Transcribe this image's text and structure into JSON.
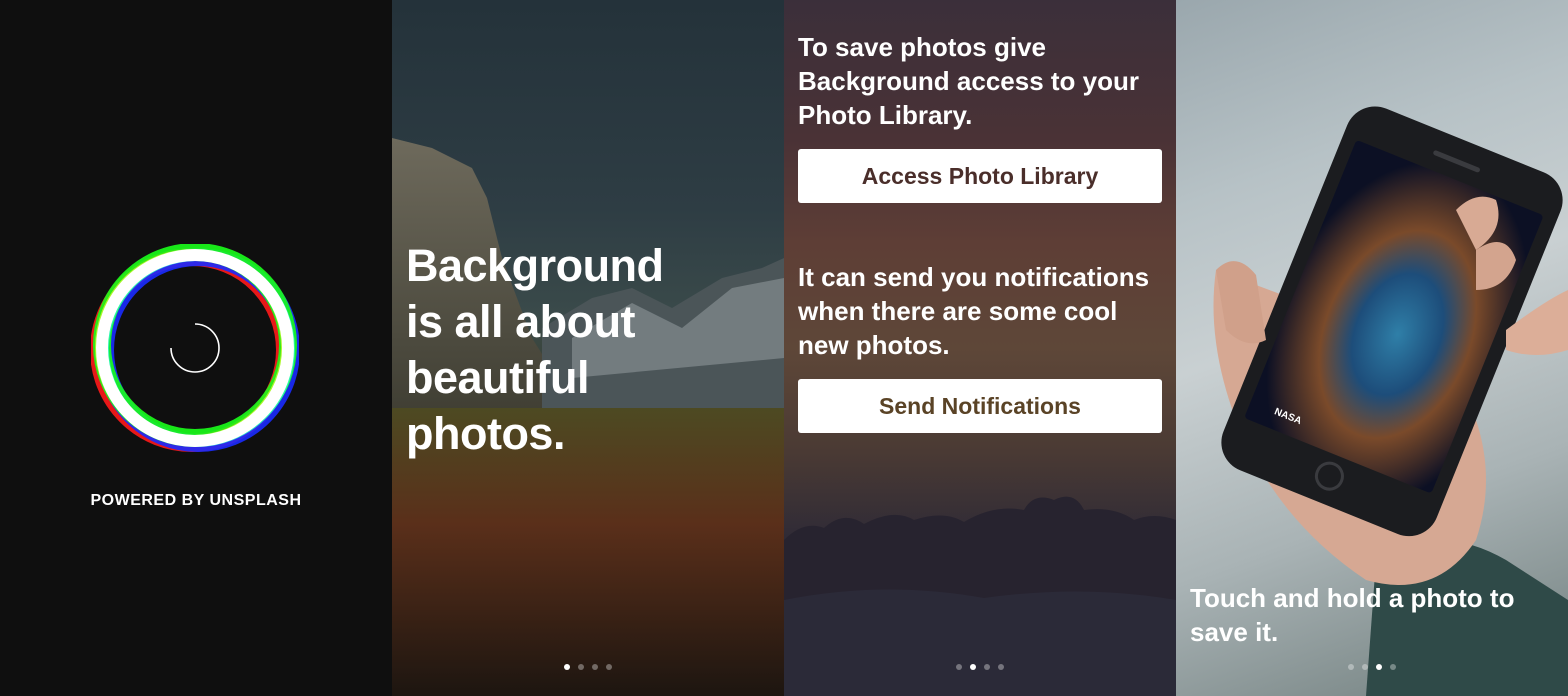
{
  "screens": [
    {
      "id": "splash",
      "powered_label": "POWERED BY UNSPLASH"
    },
    {
      "id": "intro",
      "headline_lines": [
        "Background",
        "is all about",
        "beautiful",
        "photos."
      ],
      "page_index": 1
    },
    {
      "id": "permissions",
      "photo_text": "To save photos give Background access to your Photo Library.",
      "photo_button_label": "Access Photo Library",
      "notif_text": "It can send you notifications when there are some cool new photos.",
      "notif_button_label": "Send Notifications",
      "page_index": 2
    },
    {
      "id": "save",
      "caption": "Touch and hold a photo to save it.",
      "phone_badge": "NASA",
      "page_index": 3
    }
  ],
  "page_count": 4,
  "colors": {
    "button_text_photo": "#4a2e2a",
    "button_text_notif": "#5a4326"
  }
}
